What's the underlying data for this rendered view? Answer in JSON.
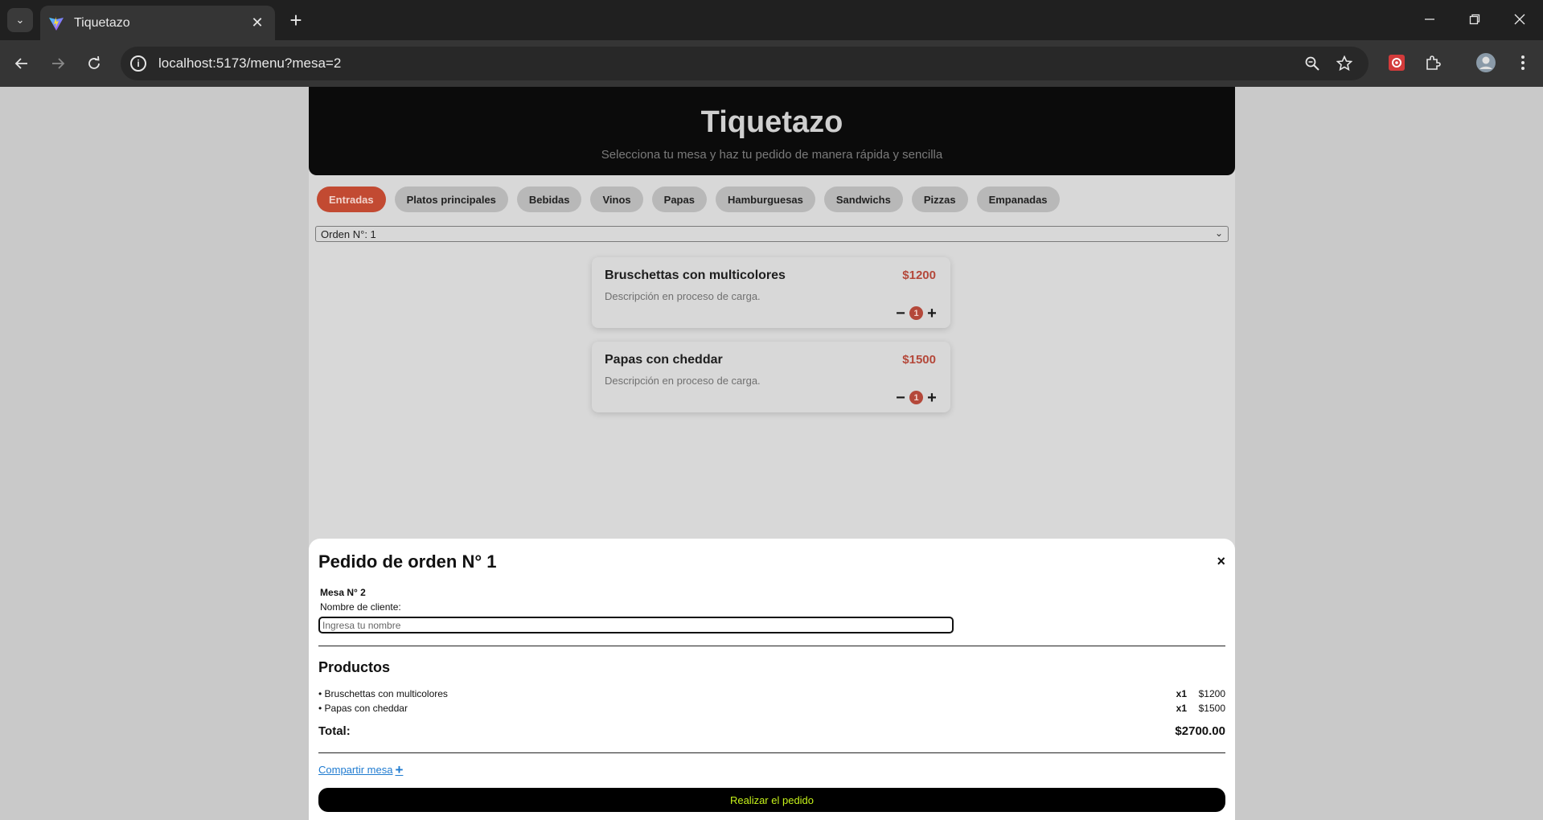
{
  "browser": {
    "tab_title": "Tiquetazo",
    "url": "localhost:5173/menu?mesa=2"
  },
  "header": {
    "title": "Tiquetazo",
    "subtitle": "Selecciona tu mesa y haz tu pedido de manera rápida y sencilla"
  },
  "categories": [
    "Entradas",
    "Platos principales",
    "Bebidas",
    "Vinos",
    "Papas",
    "Hamburguesas",
    "Sandwichs",
    "Pizzas",
    "Empanadas"
  ],
  "order_select": {
    "value": "Orden N°: 1"
  },
  "products": [
    {
      "name": "Bruschettas con multicolores",
      "price": "$1200",
      "description": "Descripción en proceso de carga.",
      "qty": "1"
    },
    {
      "name": "Papas con cheddar",
      "price": "$1500",
      "description": "Descripción en proceso de carga.",
      "qty": "1"
    }
  ],
  "order_panel": {
    "title": "Pedido de orden N° 1",
    "close": "×",
    "mesa": "Mesa N° 2",
    "client_label": "Nombre de cliente:",
    "client_placeholder": "Ingresa tu nombre",
    "products_heading": "Productos",
    "lines": [
      {
        "name": "• Bruschettas con multicolores",
        "qty": "x1",
        "price": "$1200"
      },
      {
        "name": "• Papas con cheddar",
        "qty": "x1",
        "price": "$1500"
      }
    ],
    "total_label": "Total:",
    "total_value": "$2700.00",
    "share_label": "Compartir mesa",
    "submit_label": "Realizar el pedido"
  },
  "colors": {
    "accent": "#c24a32",
    "price": "#b4483a",
    "submit_text": "#c6f21a",
    "link": "#1f7bd0"
  }
}
